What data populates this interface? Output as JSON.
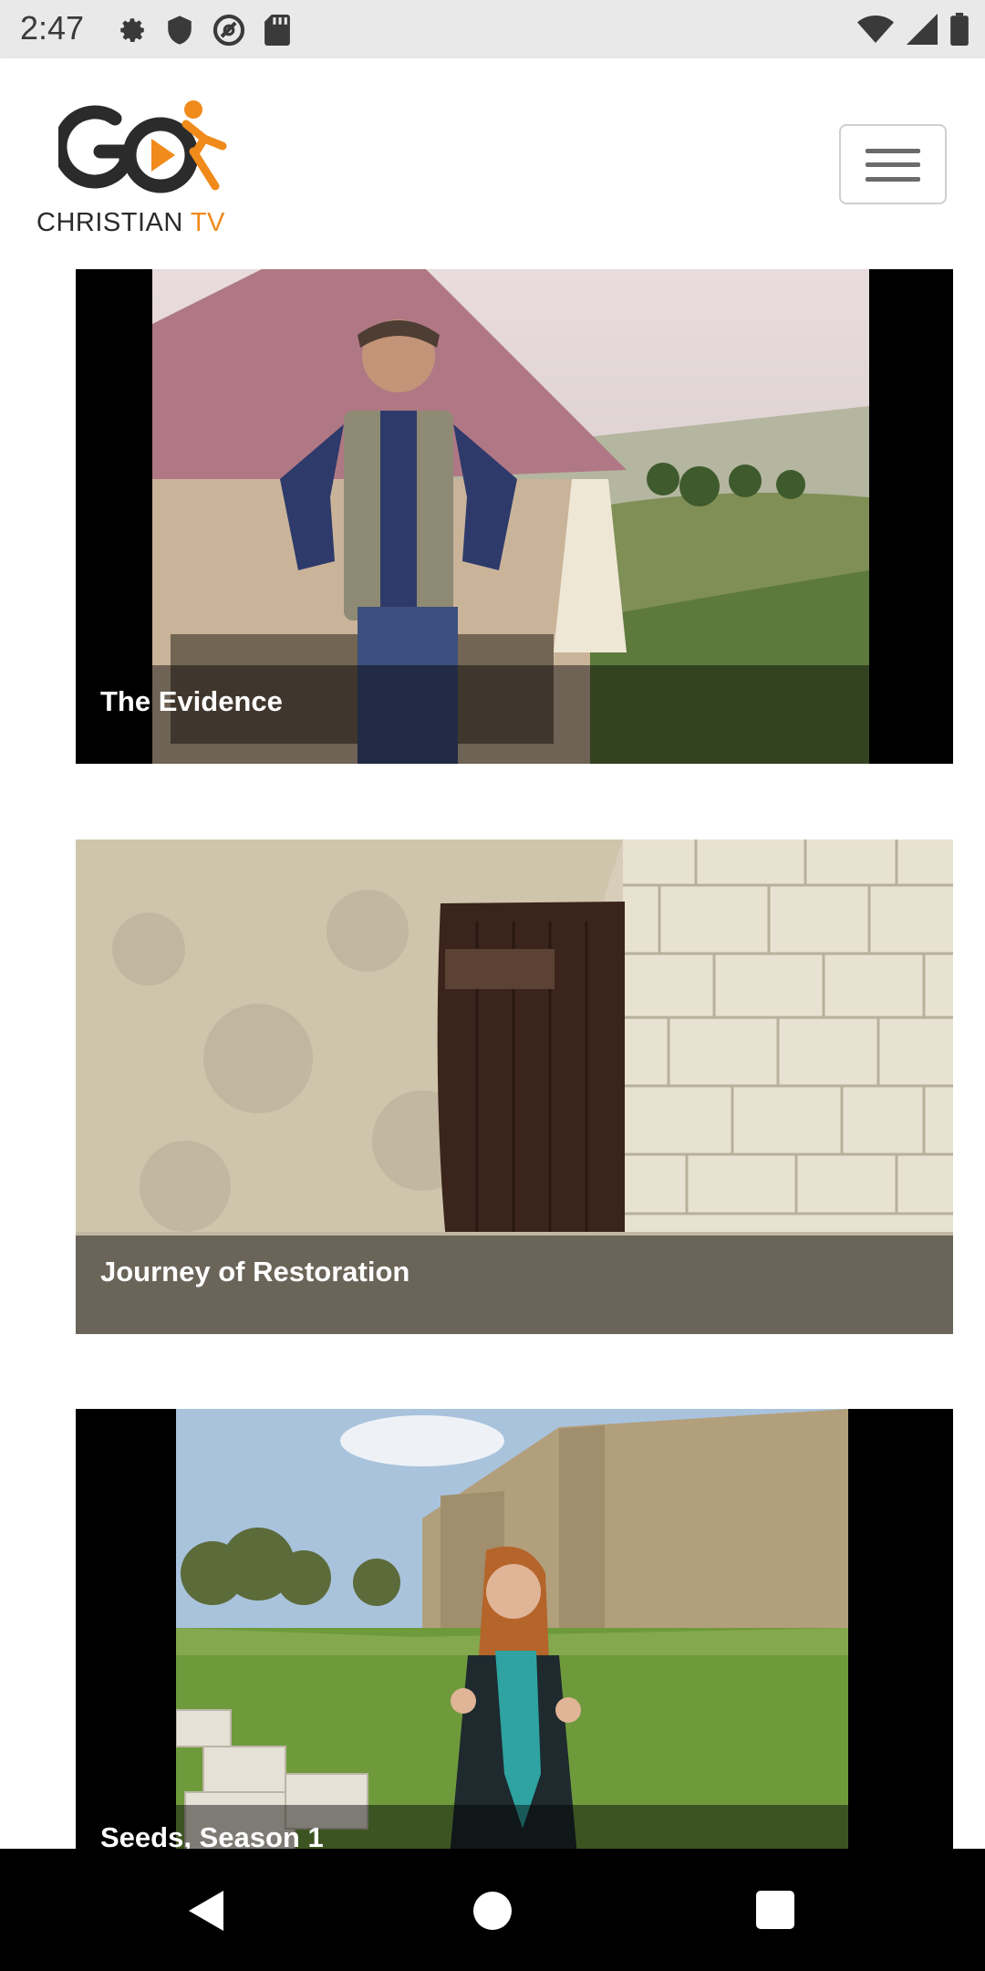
{
  "status_bar": {
    "time": "2:47",
    "left_icons": [
      "gear-icon",
      "shield-icon",
      "no-sync-icon",
      "sd-card-icon"
    ],
    "right_icons": [
      "wifi-icon",
      "cell-signal-icon",
      "battery-icon"
    ]
  },
  "header": {
    "logo": {
      "wordmark": "GO",
      "caption_main": "CHRISTIAN",
      "caption_accent": "TV"
    },
    "brand_colors": {
      "orange": "#f08a1a",
      "dark": "#2b2b2b"
    },
    "menu_icon": "hamburger-icon"
  },
  "feed": {
    "items": [
      {
        "title": "The Evidence"
      },
      {
        "title": "Journey of Restoration"
      },
      {
        "title": "Seeds, Season 1"
      }
    ]
  },
  "nav_bar": {
    "icons": [
      "back-icon",
      "home-icon",
      "recents-icon"
    ]
  }
}
